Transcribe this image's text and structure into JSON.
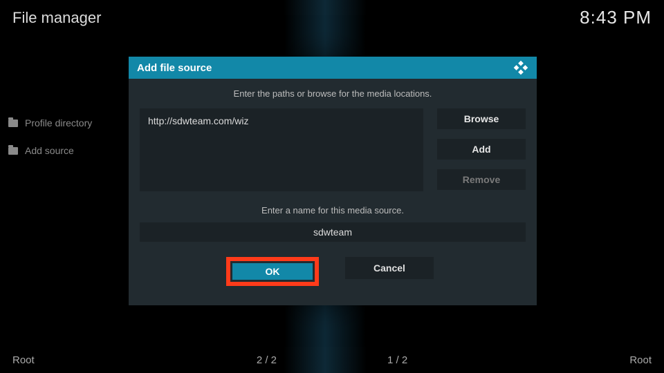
{
  "header": {
    "title": "File manager",
    "clock": "8:43 PM"
  },
  "sidebar": {
    "items": [
      {
        "label": "Profile directory"
      },
      {
        "label": "Add source"
      }
    ]
  },
  "bottombar": {
    "left": "Root",
    "center_left": "2 / 2",
    "center_right": "1 / 2",
    "right": "Root"
  },
  "dialog": {
    "title": "Add file source",
    "path_instr": "Enter the paths or browse for the media locations.",
    "path_value": "http://sdwteam.com/wiz",
    "browse": "Browse",
    "add": "Add",
    "remove": "Remove",
    "name_instr": "Enter a name for this media source.",
    "name_value": "sdwteam",
    "ok": "OK",
    "cancel": "Cancel"
  }
}
